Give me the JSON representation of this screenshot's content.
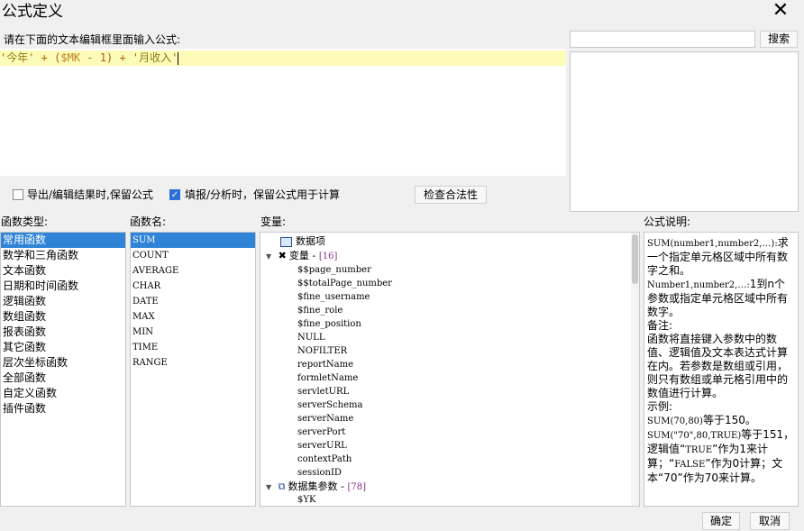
{
  "window": {
    "title": "公式定义"
  },
  "editor": {
    "prompt": "请在下面的文本编辑框里面输入公式:",
    "formula": {
      "str1": "'今年'",
      "plus1": " + ",
      "paren_open": "(",
      "var": "$MK",
      "minus": " - ",
      "num": "1",
      "paren_close": ")",
      "plus2": " + ",
      "str2": "'月收入'"
    }
  },
  "search": {
    "placeholder": "",
    "button_label": "搜索"
  },
  "options": {
    "keep_formula_on_export": {
      "label": "导出/编辑结果时,保留公式",
      "checked": false
    },
    "keep_formula_on_fill": {
      "label": "填报/分析时，保留公式用于计算",
      "checked": true
    },
    "check_button_label": "检查合法性"
  },
  "categories": {
    "header": "函数类型:",
    "items": [
      "常用函数",
      "数学和三角函数",
      "文本函数",
      "日期和时间函数",
      "逻辑函数",
      "数组函数",
      "报表函数",
      "其它函数",
      "层次坐标函数",
      "全部函数",
      "自定义函数",
      "插件函数"
    ],
    "selected": 0
  },
  "functions": {
    "header": "函数名:",
    "items": [
      "SUM",
      "COUNT",
      "AVERAGE",
      "CHAR",
      "DATE",
      "MAX",
      "MIN",
      "TIME",
      "RANGE"
    ],
    "selected": 0
  },
  "variables": {
    "header": "变量:",
    "data_item_label": "数据项",
    "var_group_label": "变量 - ",
    "var_group_count": "[16]",
    "var_items": [
      "$$page_number",
      "$$totalPage_number",
      "$fine_username",
      "$fine_role",
      "$fine_position",
      "NULL",
      "NOFILTER",
      "reportName",
      "formletName",
      "servletURL",
      "serverSchema",
      "serverName",
      "serverPort",
      "serverURL",
      "contextPath",
      "sessionID"
    ],
    "dataset_group_label": "数据集参数 - ",
    "dataset_group_count": "[78]",
    "dataset_items": [
      "$YK"
    ]
  },
  "description": {
    "header": "公式说明:",
    "line1a": "SUM(number1,number2,…):",
    "line1b": "求一个指定单元格区域中所有数字之和。",
    "line2a": "Number1,number2,…:",
    "line2b": "1到n个参数或指定单元格区域中所有数字。",
    "note_label": "备注:",
    "note_text": "函数将直接键入参数中的数值、逻辑值及文本表达式计算在内。若参数是数组或引用，则只有数组或单元格引用中的数值进行计算。",
    "example_label": "示例:",
    "ex1a": "SUM(70,80)",
    "ex1b": "等于150。",
    "ex2a": "SUM(\"70\",80,TRUE)",
    "ex2b": "等于151，逻辑值“",
    "ex2c": "TRUE",
    "ex2d": "”作为1来计算；“",
    "ex2e": "FALSE",
    "ex2f": "”作为0计算；文本“70”作为70来计算。"
  },
  "footer": {
    "ok_label": "确定",
    "cancel_label": "取消"
  }
}
